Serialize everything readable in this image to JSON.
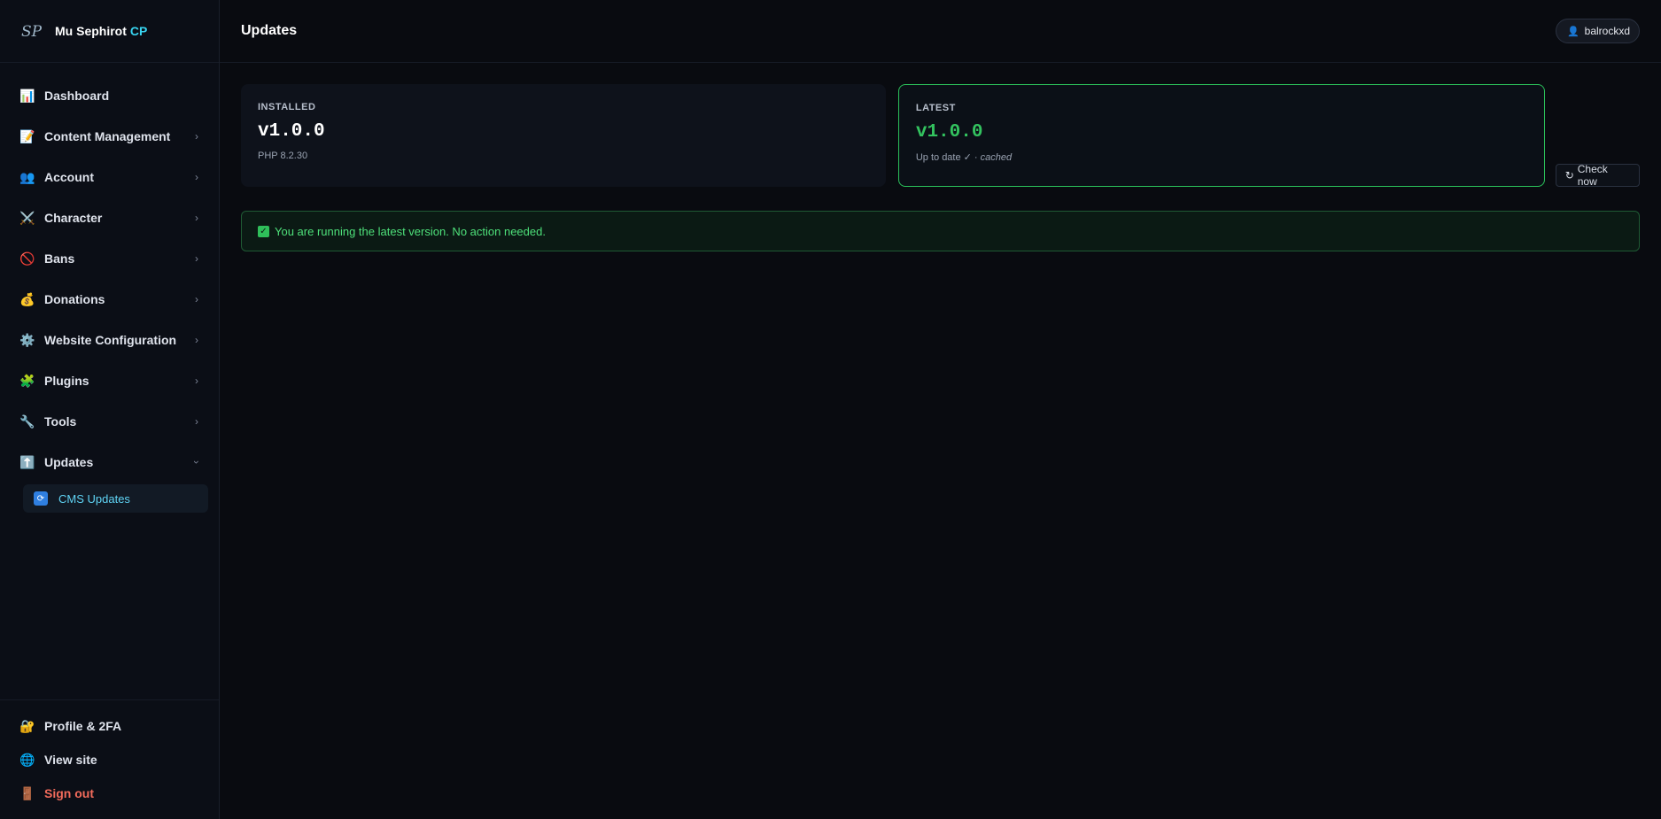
{
  "brand": {
    "name": "Mu Sephirot",
    "accent": "CP",
    "logo_text": "SP"
  },
  "sidebar": {
    "items": [
      {
        "label": "Dashboard",
        "icon": "chart-icon",
        "glyph": "📊",
        "has_children": false
      },
      {
        "label": "Content Management",
        "icon": "document-icon",
        "glyph": "📝",
        "has_children": true
      },
      {
        "label": "Account",
        "icon": "users-icon",
        "glyph": "👥",
        "has_children": true
      },
      {
        "label": "Character",
        "icon": "swords-icon",
        "glyph": "⚔️",
        "has_children": true
      },
      {
        "label": "Bans",
        "icon": "ban-icon",
        "glyph": "🚫",
        "has_children": true
      },
      {
        "label": "Donations",
        "icon": "money-bag-icon",
        "glyph": "💰",
        "has_children": true
      },
      {
        "label": "Website Configuration",
        "icon": "gear-icon",
        "glyph": "⚙️",
        "has_children": true
      },
      {
        "label": "Plugins",
        "icon": "puzzle-icon",
        "glyph": "🧩",
        "has_children": true
      },
      {
        "label": "Tools",
        "icon": "wrench-icon",
        "glyph": "🔧",
        "has_children": true
      },
      {
        "label": "Updates",
        "icon": "up-arrow-icon",
        "glyph": "⬆️",
        "has_children": true,
        "open": true
      }
    ],
    "sub_items": [
      {
        "label": "CMS Updates",
        "icon": "refresh-icon",
        "glyph": "🔄"
      }
    ],
    "footer": [
      {
        "label": "Profile & 2FA",
        "icon": "lock-icon",
        "glyph": "🔐"
      },
      {
        "label": "View site",
        "icon": "globe-icon",
        "glyph": "🌐"
      },
      {
        "label": "Sign out",
        "icon": "door-icon",
        "glyph": "🚪"
      }
    ]
  },
  "topbar": {
    "title": "Updates",
    "user": "balrockxd"
  },
  "installed": {
    "kicker": "INSTALLED",
    "version": "v1.0.0",
    "meta": "PHP 8.2.30"
  },
  "latest": {
    "kicker": "LATEST",
    "version": "v1.0.0",
    "status": "Up to date ✓ · ",
    "cached": "cached"
  },
  "check_button": {
    "label": "Check now",
    "glyph": "↻"
  },
  "alert": {
    "message": "You are running the latest version. No action needed."
  },
  "colors": {
    "accent": "#38d4f0",
    "success": "#33c35f",
    "danger": "#f26b5b",
    "background": "#090b10"
  }
}
